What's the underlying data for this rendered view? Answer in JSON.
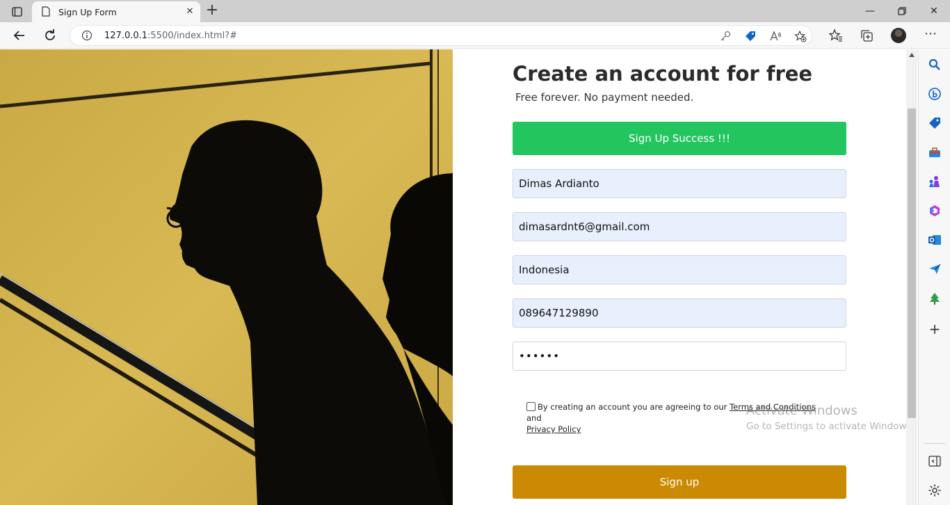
{
  "browser": {
    "tab_title": "Sign Up Form",
    "new_tab_symbol": "+",
    "url_host": "127.0.0.1",
    "url_rest": ":5500/index.html?#"
  },
  "form": {
    "heading": "Create an account for free",
    "subheading": "Free forever. No payment needed.",
    "success_message": "Sign Up Success !!!",
    "fields": {
      "name": "Dimas Ardianto",
      "email": "dimasardnt6@gmail.com",
      "country": "Indonesia",
      "phone": "089647129890",
      "password_mask": "••••••"
    },
    "terms": {
      "prefix": "By creating an account you are agreeing to our ",
      "terms_link": "Terms and Conditions",
      "and": " and",
      "privacy_link": "Privacy Policy"
    },
    "signup_label": "Sign up"
  },
  "watermark": {
    "line1": "Activate Windows",
    "line2": "Go to Settings to activate Windows."
  },
  "colors": {
    "success": "#22c55e",
    "signup": "#ca8a04",
    "photo_background": "#d4b24c"
  }
}
